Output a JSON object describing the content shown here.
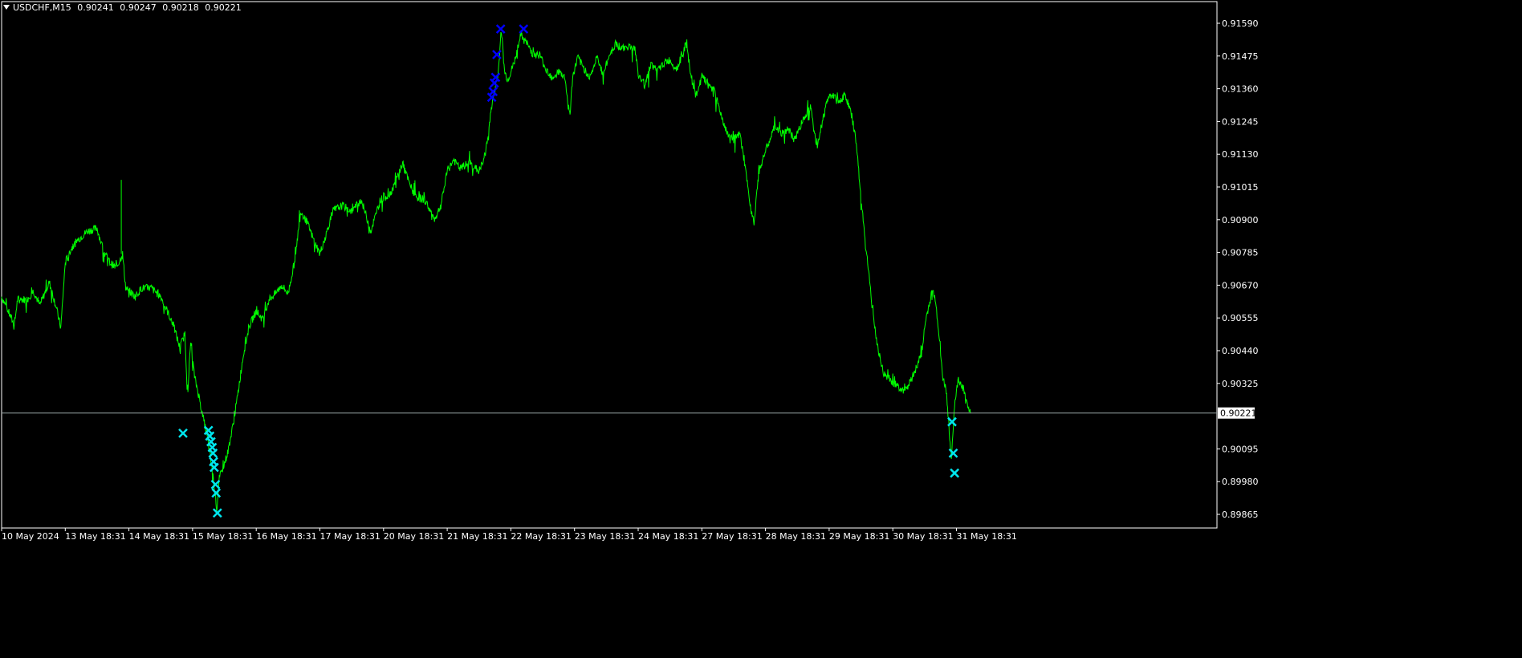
{
  "header": {
    "symbol": "USDCHF,M15",
    "open": "0.90241",
    "high": "0.90247",
    "low": "0.90218",
    "close": "0.90221"
  },
  "colors": {
    "background": "#000000",
    "price_line": "#00ff00",
    "axis": "#ffffff",
    "buy_marker": "#00e5ee",
    "sell_marker": "#0000ff",
    "current_line": "#9aa7a7"
  },
  "chart_data": {
    "type": "line",
    "symbol": "USDCHF",
    "timeframe": "M15",
    "current_price": 0.90221,
    "current_price_label": "0.90221",
    "ylim": [
      0.8984,
      0.9161
    ],
    "yticks": [
      "0.91590",
      "0.91475",
      "0.91360",
      "0.91245",
      "0.91130",
      "0.91015",
      "0.90900",
      "0.90785",
      "0.90670",
      "0.90555",
      "0.90440",
      "0.90325",
      "0.90210",
      "0.90095",
      "0.89980",
      "0.89865"
    ],
    "xticks": [
      {
        "label": "10 May 2024",
        "t": 0.0
      },
      {
        "label": "13 May 18:31",
        "t": 1.0
      },
      {
        "label": "14 May 18:31",
        "t": 2.0
      },
      {
        "label": "15 May 18:31",
        "t": 3.0
      },
      {
        "label": "16 May 18:31",
        "t": 4.0
      },
      {
        "label": "17 May 18:31",
        "t": 5.0
      },
      {
        "label": "20 May 18:31",
        "t": 6.0
      },
      {
        "label": "21 May 18:31",
        "t": 7.0
      },
      {
        "label": "22 May 18:31",
        "t": 8.0
      },
      {
        "label": "23 May 18:31",
        "t": 9.0
      },
      {
        "label": "24 May 18:31",
        "t": 10.0
      },
      {
        "label": "27 May 18:31",
        "t": 11.0
      },
      {
        "label": "28 May 18:31",
        "t": 12.0
      },
      {
        "label": "29 May 18:31",
        "t": 13.0
      },
      {
        "label": "30 May 18:31",
        "t": 14.0
      },
      {
        "label": "31 May 18:31",
        "t": 15.0
      }
    ],
    "series": [
      {
        "points": [
          [
            0.0,
            0.9063
          ],
          [
            0.1,
            0.9058
          ],
          [
            0.2,
            0.9053
          ],
          [
            0.25,
            0.9062
          ],
          [
            0.4,
            0.9062
          ],
          [
            0.5,
            0.9065
          ],
          [
            0.6,
            0.906
          ],
          [
            0.75,
            0.9068
          ],
          [
            0.85,
            0.906
          ],
          [
            0.93,
            0.9052
          ],
          [
            1.0,
            0.9075
          ],
          [
            1.1,
            0.908
          ],
          [
            1.2,
            0.9083
          ],
          [
            1.35,
            0.9086
          ],
          [
            1.5,
            0.9087
          ],
          [
            1.6,
            0.9079
          ],
          [
            1.7,
            0.9075
          ],
          [
            1.8,
            0.9073
          ],
          [
            1.9,
            0.9078
          ],
          [
            1.95,
            0.9066
          ],
          [
            2.1,
            0.9063
          ],
          [
            2.2,
            0.9066
          ],
          [
            2.35,
            0.9066
          ],
          [
            2.5,
            0.9063
          ],
          [
            2.6,
            0.9058
          ],
          [
            2.7,
            0.9053
          ],
          [
            2.8,
            0.9045
          ],
          [
            2.88,
            0.905
          ],
          [
            2.92,
            0.9028
          ],
          [
            2.97,
            0.9047
          ],
          [
            3.03,
            0.9035
          ],
          [
            3.1,
            0.9028
          ],
          [
            3.15,
            0.9022
          ],
          [
            3.22,
            0.9015
          ],
          [
            3.27,
            0.9008
          ],
          [
            3.32,
            0.9
          ],
          [
            3.36,
            0.8993
          ],
          [
            3.38,
            0.8988
          ],
          [
            3.42,
            0.8999
          ],
          [
            3.48,
            0.9003
          ],
          [
            3.55,
            0.9008
          ],
          [
            3.62,
            0.9016
          ],
          [
            3.7,
            0.9027
          ],
          [
            3.8,
            0.9043
          ],
          [
            3.9,
            0.9053
          ],
          [
            4.0,
            0.9058
          ],
          [
            4.1,
            0.9055
          ],
          [
            4.2,
            0.9062
          ],
          [
            4.3,
            0.9064
          ],
          [
            4.4,
            0.9067
          ],
          [
            4.5,
            0.9064
          ],
          [
            4.6,
            0.9075
          ],
          [
            4.7,
            0.9093
          ],
          [
            4.8,
            0.9089
          ],
          [
            4.9,
            0.9083
          ],
          [
            5.0,
            0.9078
          ],
          [
            5.1,
            0.9085
          ],
          [
            5.2,
            0.9093
          ],
          [
            5.35,
            0.9095
          ],
          [
            5.5,
            0.9093
          ],
          [
            5.65,
            0.9097
          ],
          [
            5.8,
            0.9086
          ],
          [
            5.95,
            0.9097
          ],
          [
            6.1,
            0.9099
          ],
          [
            6.2,
            0.9104
          ],
          [
            6.3,
            0.911
          ],
          [
            6.4,
            0.9103
          ],
          [
            6.5,
            0.9098
          ],
          [
            6.65,
            0.9097
          ],
          [
            6.8,
            0.909
          ],
          [
            6.9,
            0.9095
          ],
          [
            7.0,
            0.9107
          ],
          [
            7.1,
            0.9111
          ],
          [
            7.2,
            0.9108
          ],
          [
            7.35,
            0.911
          ],
          [
            7.5,
            0.9107
          ],
          [
            7.6,
            0.9113
          ],
          [
            7.7,
            0.913
          ],
          [
            7.75,
            0.9136
          ],
          [
            7.8,
            0.9141
          ],
          [
            7.85,
            0.9157
          ],
          [
            7.9,
            0.9142
          ],
          [
            7.95,
            0.9139
          ],
          [
            8.05,
            0.9145
          ],
          [
            8.15,
            0.9155
          ],
          [
            8.25,
            0.9152
          ],
          [
            8.35,
            0.9148
          ],
          [
            8.45,
            0.9148
          ],
          [
            8.55,
            0.9143
          ],
          [
            8.65,
            0.914
          ],
          [
            8.75,
            0.9142
          ],
          [
            8.85,
            0.914
          ],
          [
            8.9,
            0.913
          ],
          [
            8.93,
            0.9127
          ],
          [
            8.97,
            0.914
          ],
          [
            9.05,
            0.9147
          ],
          [
            9.15,
            0.9143
          ],
          [
            9.25,
            0.914
          ],
          [
            9.35,
            0.9147
          ],
          [
            9.45,
            0.9141
          ],
          [
            9.55,
            0.9148
          ],
          [
            9.65,
            0.9152
          ],
          [
            9.75,
            0.915
          ],
          [
            9.85,
            0.9151
          ],
          [
            9.95,
            0.915
          ],
          [
            10.0,
            0.9141
          ],
          [
            10.1,
            0.9137
          ],
          [
            10.2,
            0.9145
          ],
          [
            10.3,
            0.9142
          ],
          [
            10.4,
            0.9145
          ],
          [
            10.5,
            0.9146
          ],
          [
            10.6,
            0.9143
          ],
          [
            10.7,
            0.9148
          ],
          [
            10.75,
            0.9152
          ],
          [
            10.82,
            0.9142
          ],
          [
            10.9,
            0.9133
          ],
          [
            11.0,
            0.914
          ],
          [
            11.1,
            0.9138
          ],
          [
            11.2,
            0.9135
          ],
          [
            11.3,
            0.9127
          ],
          [
            11.4,
            0.912
          ],
          [
            11.5,
            0.9118
          ],
          [
            11.6,
            0.912
          ],
          [
            11.7,
            0.9105
          ],
          [
            11.77,
            0.9094
          ],
          [
            11.82,
            0.9089
          ],
          [
            11.88,
            0.9104
          ],
          [
            11.95,
            0.9111
          ],
          [
            12.05,
            0.9117
          ],
          [
            12.15,
            0.9123
          ],
          [
            12.25,
            0.912
          ],
          [
            12.35,
            0.9122
          ],
          [
            12.45,
            0.9118
          ],
          [
            12.55,
            0.9123
          ],
          [
            12.65,
            0.9128
          ],
          [
            12.72,
            0.913
          ],
          [
            12.8,
            0.9115
          ],
          [
            12.9,
            0.9125
          ],
          [
            12.97,
            0.9132
          ],
          [
            13.05,
            0.9134
          ],
          [
            13.15,
            0.9131
          ],
          [
            13.25,
            0.9134
          ],
          [
            13.35,
            0.9127
          ],
          [
            13.42,
            0.9118
          ],
          [
            13.5,
            0.9098
          ],
          [
            13.57,
            0.9082
          ],
          [
            13.62,
            0.9072
          ],
          [
            13.68,
            0.9058
          ],
          [
            13.75,
            0.9047
          ],
          [
            13.85,
            0.9036
          ],
          [
            13.95,
            0.9034
          ],
          [
            14.05,
            0.9032
          ],
          [
            14.15,
            0.903
          ],
          [
            14.25,
            0.9032
          ],
          [
            14.35,
            0.9037
          ],
          [
            14.45,
            0.9043
          ],
          [
            14.52,
            0.9055
          ],
          [
            14.58,
            0.9061
          ],
          [
            14.63,
            0.9066
          ],
          [
            14.68,
            0.906
          ],
          [
            14.73,
            0.9048
          ],
          [
            14.78,
            0.9035
          ],
          [
            14.84,
            0.903
          ],
          [
            14.88,
            0.9018
          ],
          [
            14.92,
            0.9006
          ],
          [
            14.97,
            0.9025
          ],
          [
            15.03,
            0.9034
          ],
          [
            15.1,
            0.9031
          ],
          [
            15.17,
            0.9026
          ],
          [
            15.22,
            0.9022
          ]
        ]
      }
    ],
    "markers": [
      {
        "kind": "buy",
        "t": 2.85,
        "price": 0.9015
      },
      {
        "kind": "buy",
        "t": 3.25,
        "price": 0.9016
      },
      {
        "kind": "buy",
        "t": 3.27,
        "price": 0.9014
      },
      {
        "kind": "buy",
        "t": 3.29,
        "price": 0.9012
      },
      {
        "kind": "buy",
        "t": 3.31,
        "price": 0.901
      },
      {
        "kind": "buy",
        "t": 3.32,
        "price": 0.9008
      },
      {
        "kind": "buy",
        "t": 3.33,
        "price": 0.9005
      },
      {
        "kind": "buy",
        "t": 3.34,
        "price": 0.9003
      },
      {
        "kind": "buy",
        "t": 3.36,
        "price": 0.8997
      },
      {
        "kind": "buy",
        "t": 3.37,
        "price": 0.8994
      },
      {
        "kind": "buy",
        "t": 3.39,
        "price": 0.8987
      },
      {
        "kind": "sell",
        "t": 7.7,
        "price": 0.9133
      },
      {
        "kind": "sell",
        "t": 7.72,
        "price": 0.9135
      },
      {
        "kind": "sell",
        "t": 7.74,
        "price": 0.9138
      },
      {
        "kind": "sell",
        "t": 7.76,
        "price": 0.914
      },
      {
        "kind": "sell",
        "t": 7.78,
        "price": 0.9148
      },
      {
        "kind": "sell",
        "t": 7.84,
        "price": 0.9157
      },
      {
        "kind": "sell",
        "t": 8.2,
        "price": 0.9157
      },
      {
        "kind": "buy",
        "t": 14.93,
        "price": 0.9019
      },
      {
        "kind": "buy",
        "t": 14.95,
        "price": 0.9008
      },
      {
        "kind": "buy",
        "t": 14.97,
        "price": 0.9001
      }
    ]
  }
}
